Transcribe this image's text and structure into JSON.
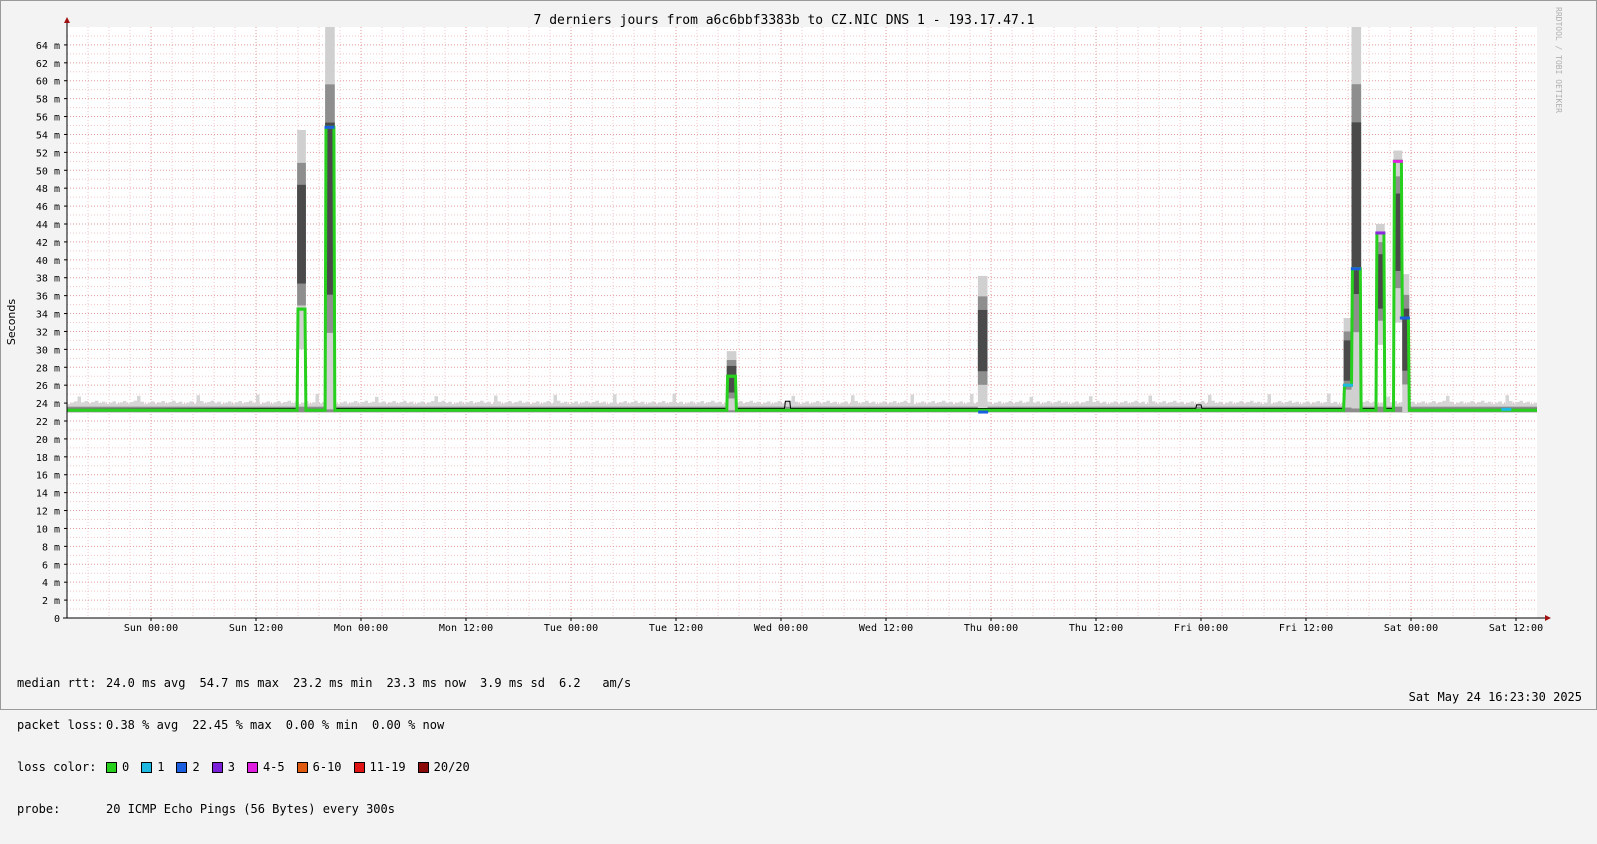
{
  "chart_data": {
    "type": "line",
    "title": "7 derniers jours from a6c6bbf3383b to CZ.NIC DNS 1 - 193.17.47.1",
    "ylabel": "Seconds",
    "watermark": "RRDTOOL / TOBI OETIKER",
    "ylim": [
      0,
      66
    ],
    "y_ticks": [
      {
        "v": 0,
        "label": "0"
      },
      {
        "v": 2,
        "label": "2 m"
      },
      {
        "v": 4,
        "label": "4 m"
      },
      {
        "v": 6,
        "label": "6 m"
      },
      {
        "v": 8,
        "label": "8 m"
      },
      {
        "v": 10,
        "label": "10 m"
      },
      {
        "v": 12,
        "label": "12 m"
      },
      {
        "v": 14,
        "label": "14 m"
      },
      {
        "v": 16,
        "label": "16 m"
      },
      {
        "v": 18,
        "label": "18 m"
      },
      {
        "v": 20,
        "label": "20 m"
      },
      {
        "v": 22,
        "label": "22 m"
      },
      {
        "v": 24,
        "label": "24 m"
      },
      {
        "v": 26,
        "label": "26 m"
      },
      {
        "v": 28,
        "label": "28 m"
      },
      {
        "v": 30,
        "label": "30 m"
      },
      {
        "v": 32,
        "label": "32 m"
      },
      {
        "v": 34,
        "label": "34 m"
      },
      {
        "v": 36,
        "label": "36 m"
      },
      {
        "v": 38,
        "label": "38 m"
      },
      {
        "v": 40,
        "label": "40 m"
      },
      {
        "v": 42,
        "label": "42 m"
      },
      {
        "v": 44,
        "label": "44 m"
      },
      {
        "v": 46,
        "label": "46 m"
      },
      {
        "v": 48,
        "label": "48 m"
      },
      {
        "v": 50,
        "label": "50 m"
      },
      {
        "v": 52,
        "label": "52 m"
      },
      {
        "v": 54,
        "label": "54 m"
      },
      {
        "v": 56,
        "label": "56 m"
      },
      {
        "v": 58,
        "label": "58 m"
      },
      {
        "v": 60,
        "label": "60 m"
      },
      {
        "v": 62,
        "label": "62 m"
      },
      {
        "v": 64,
        "label": "64 m"
      }
    ],
    "x_range_hours": [
      0,
      168
    ],
    "x_ticks": [
      {
        "h": 9.6,
        "label": "Sun 00:00"
      },
      {
        "h": 21.6,
        "label": "Sun 12:00"
      },
      {
        "h": 33.6,
        "label": "Mon 00:00"
      },
      {
        "h": 45.6,
        "label": "Mon 12:00"
      },
      {
        "h": 57.6,
        "label": "Tue 00:00"
      },
      {
        "h": 69.6,
        "label": "Tue 12:00"
      },
      {
        "h": 81.6,
        "label": "Wed 00:00"
      },
      {
        "h": 93.6,
        "label": "Wed 12:00"
      },
      {
        "h": 105.6,
        "label": "Thu 00:00"
      },
      {
        "h": 117.6,
        "label": "Thu 12:00"
      },
      {
        "h": 129.6,
        "label": "Fri 00:00"
      },
      {
        "h": 141.6,
        "label": "Fri 12:00"
      },
      {
        "h": 153.6,
        "label": "Sat 00:00"
      },
      {
        "h": 165.6,
        "label": "Sat 12:00"
      }
    ],
    "median_rtt_series": {
      "name": "median rtt",
      "points": [
        [
          0,
          23.3
        ],
        [
          26.3,
          23.4
        ],
        [
          26.4,
          34.5
        ],
        [
          27.2,
          34.5
        ],
        [
          27.3,
          23.3
        ],
        [
          29.5,
          23.3
        ],
        [
          29.6,
          54.8
        ],
        [
          30.5,
          54.8
        ],
        [
          30.6,
          23.4
        ],
        [
          75.4,
          23.4
        ],
        [
          75.5,
          27.0
        ],
        [
          76.4,
          27.0
        ],
        [
          76.5,
          23.4
        ],
        [
          82.0,
          23.4
        ],
        [
          82.1,
          24.2
        ],
        [
          82.6,
          24.2
        ],
        [
          82.7,
          23.4
        ],
        [
          129.0,
          23.4
        ],
        [
          129.1,
          23.8
        ],
        [
          129.6,
          23.8
        ],
        [
          129.7,
          23.4
        ],
        [
          145.9,
          23.4
        ],
        [
          146.0,
          26.0
        ],
        [
          146.8,
          26.0
        ],
        [
          146.9,
          39.0
        ],
        [
          147.8,
          39.0
        ],
        [
          147.9,
          23.4
        ],
        [
          149.6,
          23.4
        ],
        [
          149.7,
          43.0
        ],
        [
          150.5,
          43.0
        ],
        [
          150.6,
          23.4
        ],
        [
          151.6,
          23.4
        ],
        [
          151.7,
          51.0
        ],
        [
          152.5,
          51.0
        ],
        [
          152.6,
          33.5
        ],
        [
          153.3,
          33.5
        ],
        [
          153.4,
          23.3
        ],
        [
          168,
          23.3
        ]
      ],
      "loss_markers": [
        {
          "h": 26.8,
          "v": 34.5,
          "color": "#26d01d"
        },
        {
          "h": 30.0,
          "v": 54.8,
          "color": "#1a5fe0"
        },
        {
          "h": 75.9,
          "v": 27.0,
          "color": "#26d01d"
        },
        {
          "h": 104.7,
          "v": 23.0,
          "color": "#1a5fe0"
        },
        {
          "h": 146.4,
          "v": 26.0,
          "color": "#1fb8e0"
        },
        {
          "h": 147.3,
          "v": 39.0,
          "color": "#1a5fe0"
        },
        {
          "h": 150.1,
          "v": 43.0,
          "color": "#8a2be2"
        },
        {
          "h": 152.1,
          "v": 51.0,
          "color": "#e01ee0"
        },
        {
          "h": 152.9,
          "v": 33.5,
          "color": "#1a5fe0"
        },
        {
          "h": 164.5,
          "v": 23.3,
          "color": "#1fb8e0"
        }
      ]
    },
    "smoke_bands": [
      {
        "h0": 26.3,
        "h1": 27.3,
        "v0": 30.0,
        "v1": 54.5
      },
      {
        "h0": 29.5,
        "h1": 30.6,
        "v0": 23.3,
        "v1": 66.0
      },
      {
        "h0": 75.4,
        "h1": 76.5,
        "v0": 23.2,
        "v1": 29.8
      },
      {
        "h0": 104.1,
        "h1": 105.2,
        "v0": 23.0,
        "v1": 38.2
      },
      {
        "h0": 145.9,
        "h1": 146.9,
        "v0": 23.5,
        "v1": 33.5
      },
      {
        "h0": 146.8,
        "h1": 147.9,
        "v0": 23.4,
        "v1": 66.0
      },
      {
        "h0": 149.6,
        "h1": 150.6,
        "v0": 30.5,
        "v1": 44.0
      },
      {
        "h0": 151.6,
        "h1": 152.6,
        "v0": 33.0,
        "v1": 52.2
      },
      {
        "h0": 152.6,
        "h1": 153.4,
        "v0": 23.0,
        "v1": 38.4
      }
    ],
    "grid": true
  },
  "legend": {
    "median_rtt": {
      "label": "median rtt:",
      "values": [
        "24.0 ms avg",
        "54.7 ms max",
        "23.2 ms min",
        "23.3 ms now",
        "3.9 ms sd",
        "6.2   am/s"
      ]
    },
    "packet_loss": {
      "label": "packet loss:",
      "values": [
        "0.38 % avg",
        "22.45 % max",
        "0.00 % min",
        "0.00 % now"
      ]
    },
    "loss_color": {
      "label": "loss color:",
      "items": [
        {
          "label": "0",
          "color": "#26d01d"
        },
        {
          "label": "1",
          "color": "#1fb8e0"
        },
        {
          "label": "2",
          "color": "#1a5fe0"
        },
        {
          "label": "3",
          "color": "#7a20d8"
        },
        {
          "label": "4-5",
          "color": "#e01ee0"
        },
        {
          "label": "6-10",
          "color": "#e05a10"
        },
        {
          "label": "11-19",
          "color": "#e01414"
        },
        {
          "label": "20/20",
          "color": "#8a0a0a"
        }
      ]
    },
    "probe": {
      "label": "probe:",
      "value": "20 ICMP Echo Pings (56 Bytes) every 300s"
    }
  },
  "timestamp": "Sat May 24 16:23:30 2025"
}
